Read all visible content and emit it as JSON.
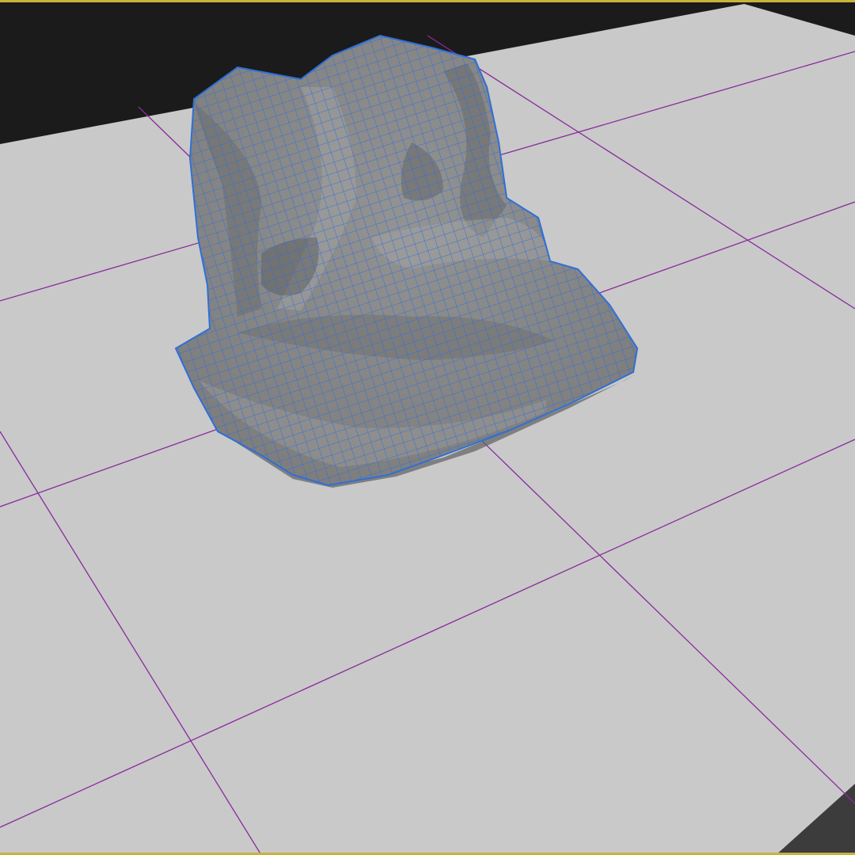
{
  "viewport": {
    "view": "perspective",
    "shading": "smooth-shade-with-wireframe-on-shaded",
    "selected_object": "cloth-mesh"
  },
  "colors": {
    "viewport_background": "#1b1b1b",
    "ground_plane": "#c9c9c9",
    "ground_plane_edge": "#3c3c3c",
    "grid_line": "#8a2a9e",
    "mesh_fill": "#8a8a8a",
    "mesh_shadow": "#5f5f5f",
    "wireframe": "#2f6fd6",
    "active_frame": "#c9b23a"
  },
  "icons": [
    "viewport-frame-icon"
  ]
}
